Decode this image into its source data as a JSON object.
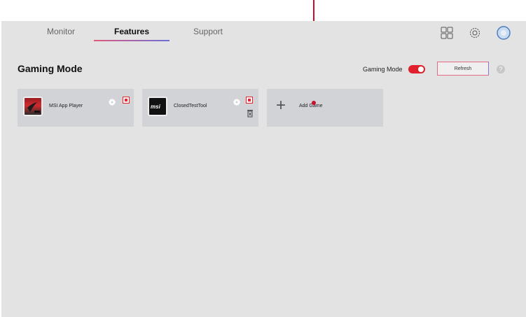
{
  "tabs": [
    {
      "label": "Monitor"
    },
    {
      "label": "Features"
    },
    {
      "label": "Support"
    }
  ],
  "header_icons": [
    "grid-icon",
    "settings-icon",
    "profile-icon"
  ],
  "page": {
    "title": "Gaming Mode",
    "gaming_mode_label": "Gaming Mode",
    "gaming_mode_on": true,
    "refresh_label": "Refresh",
    "help_label": "?"
  },
  "games": [
    {
      "name": "MSI App Player",
      "has_delete": false
    },
    {
      "name": "ClosedTestTool",
      "has_delete": true
    }
  ],
  "add_game": {
    "label": "Add Game",
    "icon": "+"
  },
  "colors": {
    "accent_red": "#e0202d",
    "annotation": "#c8102e",
    "background": "#e3e3e3",
    "card": "#d2d3d7"
  }
}
